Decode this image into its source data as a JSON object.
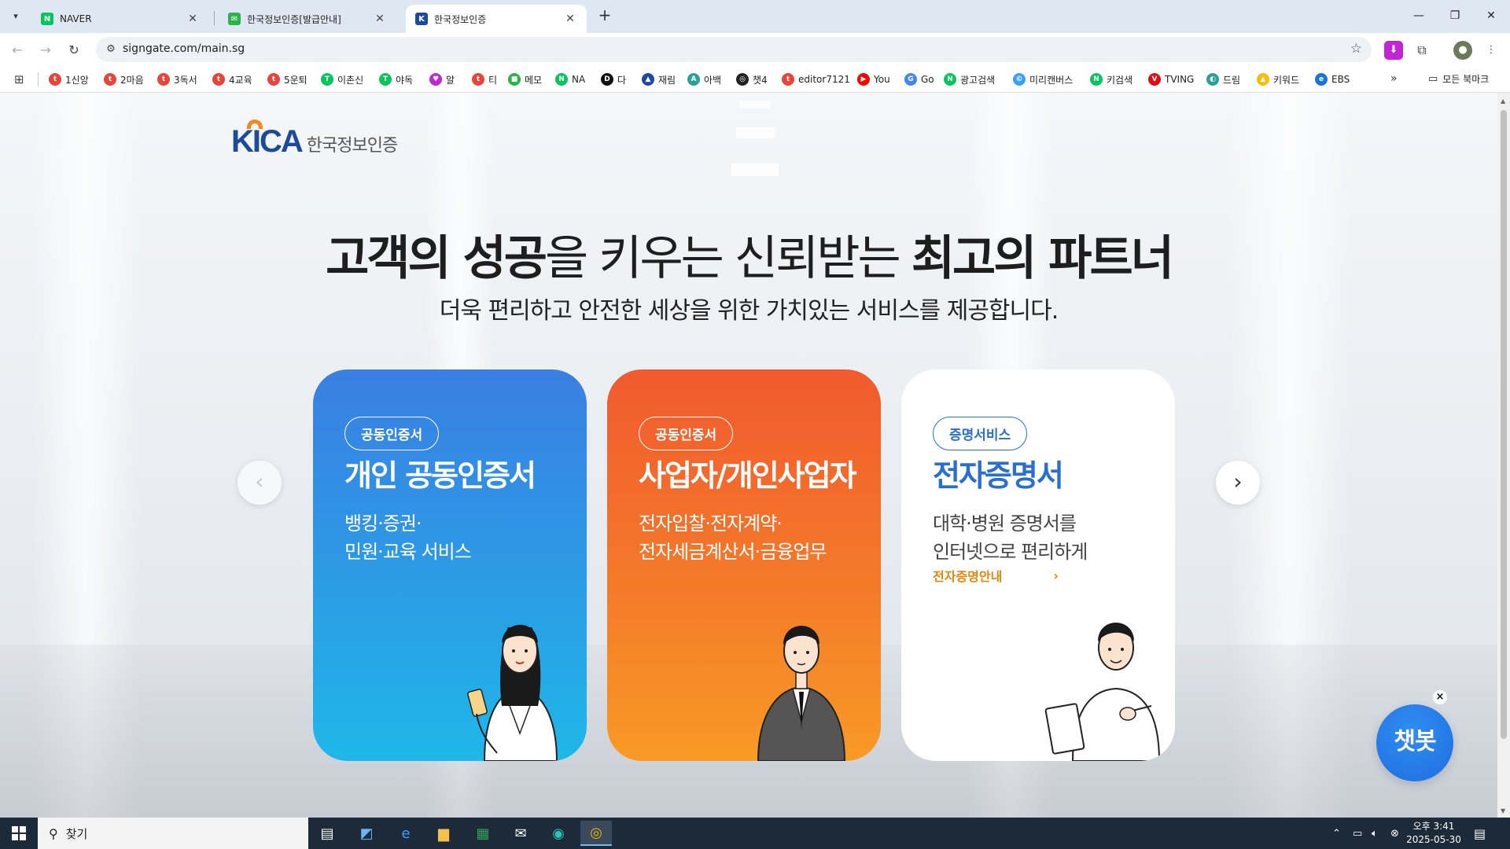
{
  "browser": {
    "tabs": [
      {
        "label": "NAVER",
        "active": false
      },
      {
        "label": "한국정보인증[발급안내]",
        "active": false
      },
      {
        "label": "한국정보인증",
        "active": true
      }
    ],
    "url": "signgate.com/main.sg",
    "bookmarks": [
      "1신앙",
      "2마음",
      "3독서",
      "4교육",
      "5운퇴",
      "이촌신",
      "야독",
      "알",
      "티",
      "메모",
      "NA",
      "다",
      "재림",
      "아백",
      "챗4",
      "editor7121",
      "You",
      "Go",
      "광고검색",
      "미리캔버스",
      "키검색",
      "TVING",
      "드림",
      "키워드",
      "EBS"
    ],
    "all_bookmarks_label": "모든 북마크",
    "more_label": "»"
  },
  "page": {
    "logo": {
      "brand": "KICA",
      "korean": "한국정보인증"
    },
    "hero": {
      "title_parts": [
        "고객의 성공",
        "을 키우는 신뢰받는 ",
        "최고의 파트너"
      ],
      "subtitle": "더욱 편리하고 안전한 세상을 위한 가치있는 서비스를 제공합니다."
    },
    "cards": [
      {
        "pill": "공동인증서",
        "title": "개인 공동인증서",
        "desc1": "뱅킹·증권·",
        "desc2": "민원·교육 서비스",
        "color": "#2f8ee4"
      },
      {
        "pill": "공동인증서",
        "title": "사업자/개인사업자",
        "desc1": "전자입찰·전자계약·",
        "desc2": "전자세금계산서·금융업무",
        "color": "#f3702b"
      },
      {
        "pill": "증명서비스",
        "title": "전자증명서",
        "desc1": "대학·병원 증명서를",
        "desc2": "인터넷으로 편리하게",
        "link": "전자증명안내",
        "color": "#2a6fd0"
      }
    ],
    "nav": {
      "prev": "‹",
      "next": "›"
    },
    "chatbot": {
      "label": "챗봇",
      "close": "×"
    }
  },
  "taskbar": {
    "search_placeholder": "찾기",
    "clock_time": "오후 3:41",
    "clock_date": "2025-05-30"
  }
}
